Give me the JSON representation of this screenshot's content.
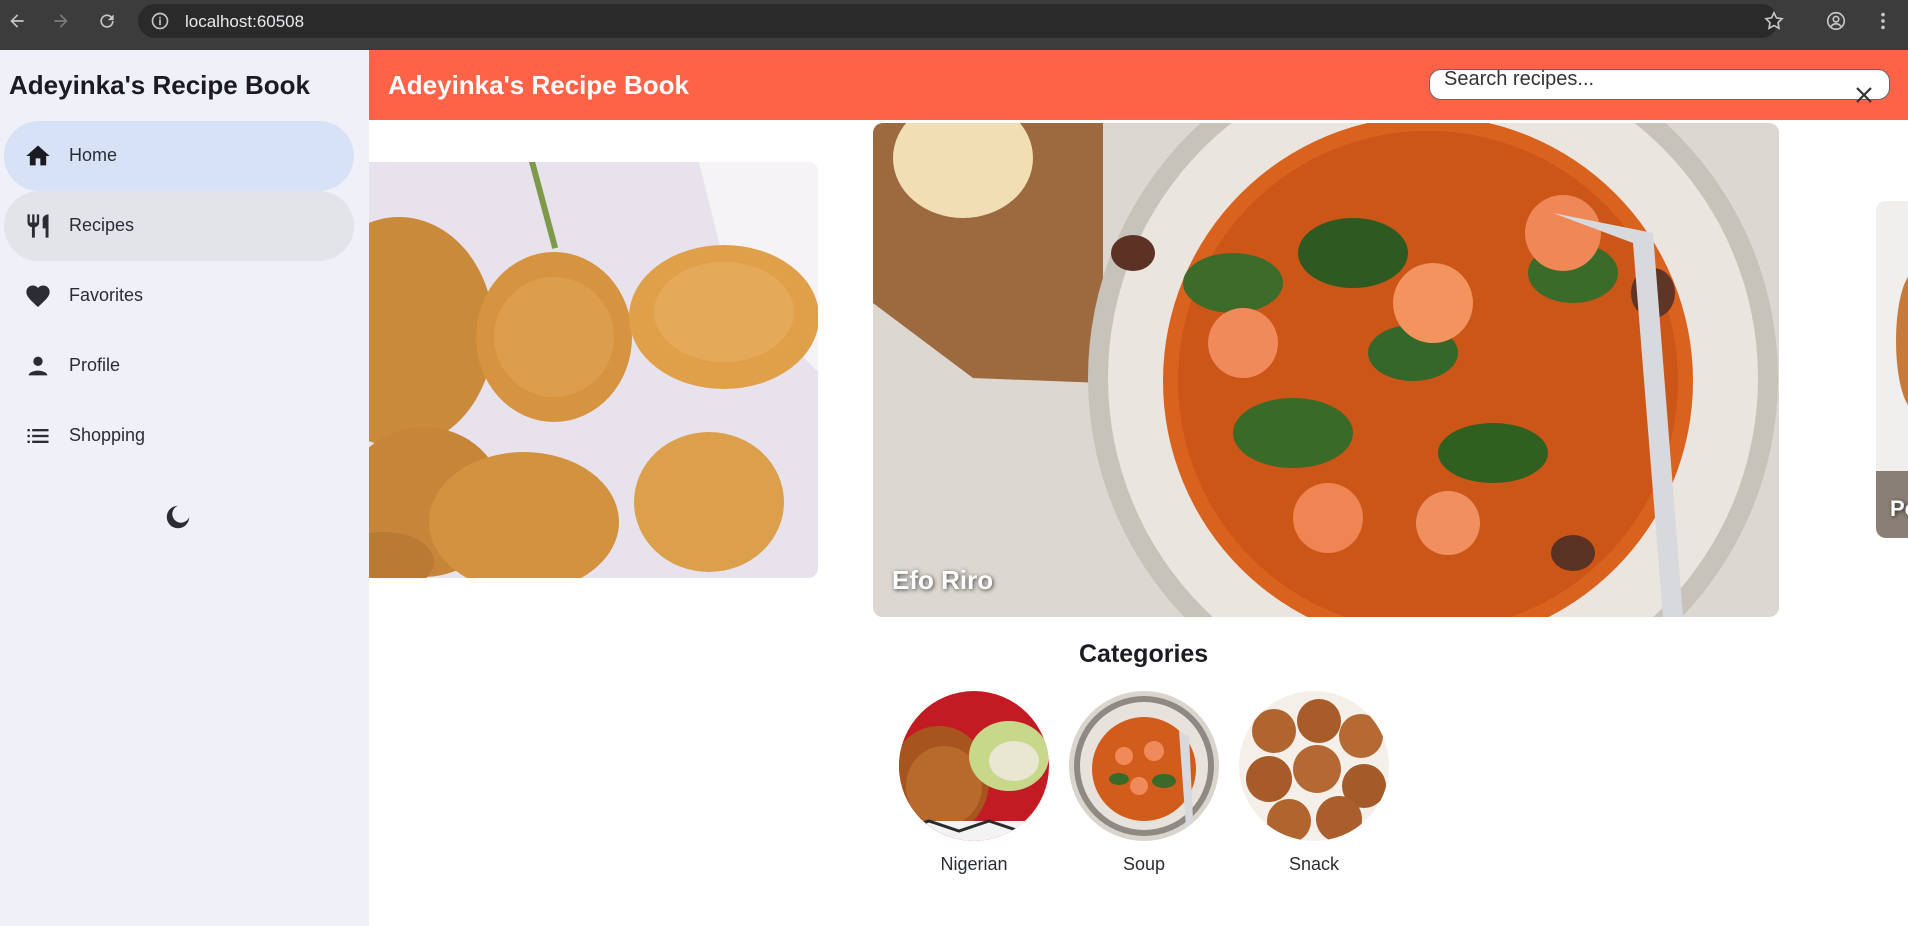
{
  "browser": {
    "url": "localhost:60508",
    "icons": [
      "back-arrow-icon",
      "forward-arrow-icon",
      "reload-icon",
      "info-icon",
      "star-icon",
      "account-icon",
      "menu-kebab-icon"
    ]
  },
  "sidebar": {
    "title": "Adeyinka's Recipe Book",
    "items": [
      {
        "label": "Home",
        "icon": "home-icon",
        "state": "selected"
      },
      {
        "label": "Recipes",
        "icon": "restaurant-icon",
        "state": "hovered"
      },
      {
        "label": "Favorites",
        "icon": "heart-icon",
        "state": "default"
      },
      {
        "label": "Profile",
        "icon": "person-icon",
        "state": "default"
      },
      {
        "label": "Shopping",
        "icon": "list-icon",
        "state": "default"
      }
    ],
    "theme_toggle_icon": "moon-icon"
  },
  "appbar": {
    "title": "Adeyinka's Recipe Book",
    "search_placeholder": "Search recipes...",
    "clear_icon": "close-icon"
  },
  "carousel": {
    "cards": [
      {
        "caption": "",
        "image": "fried-snack-balls-photo"
      },
      {
        "caption": "Efo Riro",
        "image": "efo-riro-stew-photo"
      },
      {
        "caption": "Po",
        "image": "partial-dish-photo"
      }
    ]
  },
  "categories": {
    "title": "Categories",
    "items": [
      {
        "label": "Nigerian",
        "image": "jollof-rice-photo"
      },
      {
        "label": "Soup",
        "image": "soup-bowl-photo"
      },
      {
        "label": "Snack",
        "image": "puff-puff-photo"
      }
    ]
  },
  "colors": {
    "appbar": "#ff6347",
    "sidebar_bg": "#eff0f8",
    "selected_item": "#d7e2f6",
    "hovered_item": "#e3e4ea"
  }
}
